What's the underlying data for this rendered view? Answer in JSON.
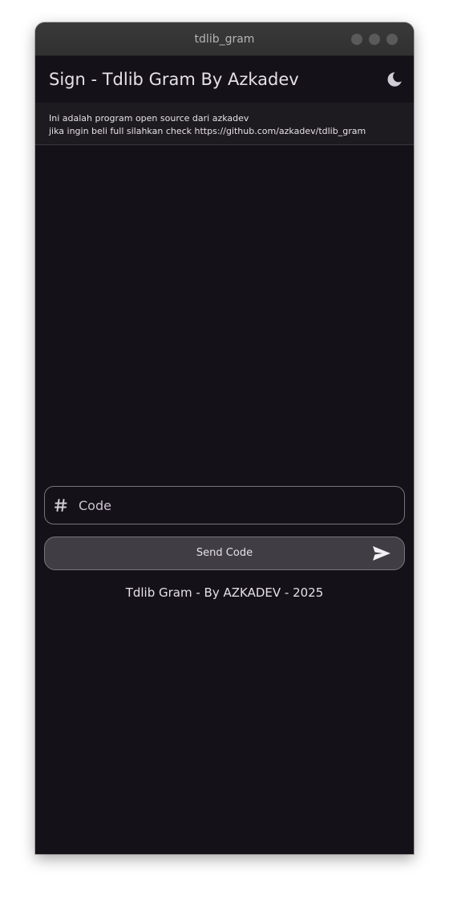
{
  "window": {
    "title": "tdlib_gram",
    "controls": [
      "minimize-icon",
      "maximize-icon",
      "close-icon"
    ]
  },
  "appbar": {
    "title": "Sign - Tdlib Gram By Azkadev",
    "theme_icon": "moon-icon"
  },
  "banner": {
    "line1": "Ini adalah program open source dari azkadev",
    "line2": "jika ingin beli full silahkan check https://github.com/azkadev/tdlib_gram"
  },
  "form": {
    "code_placeholder": "Code",
    "code_value": "",
    "code_icon": "hash-icon",
    "send_label": "Send Code",
    "send_icon": "send-icon"
  },
  "footer": {
    "text": "Tdlib Gram - By AZKADEV - 2025"
  },
  "colors": {
    "background": "#141218",
    "banner": "#1d1b20",
    "button": "#403e44",
    "outline": "#79747e",
    "text": "#e6e0e9",
    "titlebar": "#353535"
  }
}
